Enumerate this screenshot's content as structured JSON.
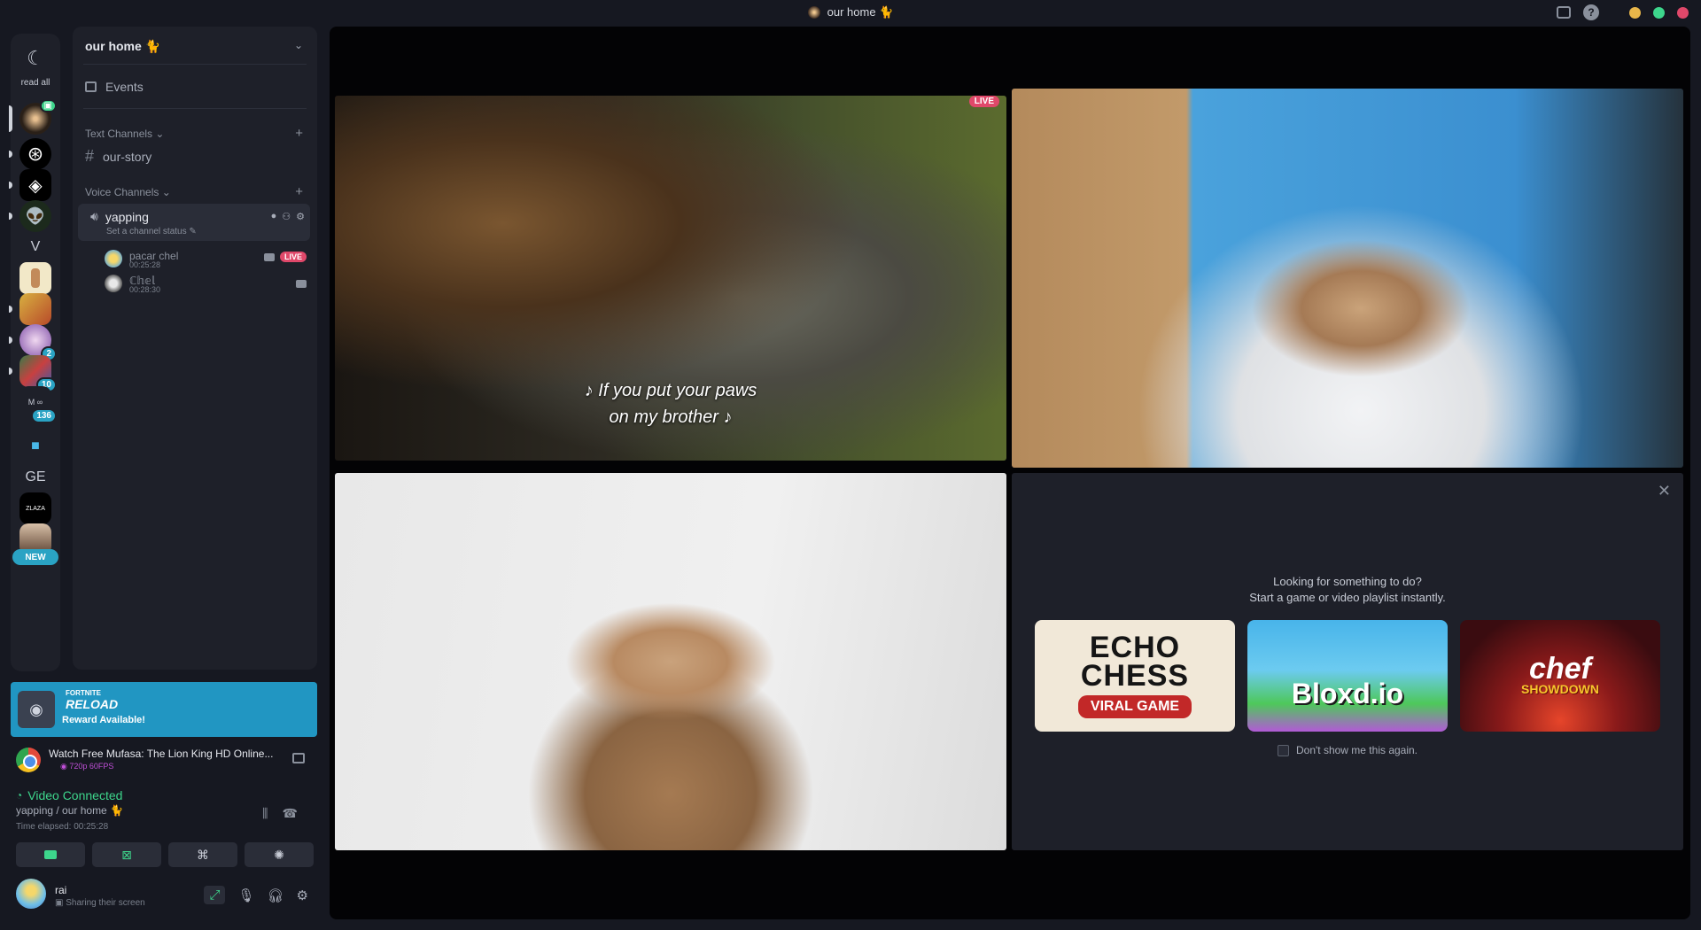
{
  "window": {
    "title": "our home 🐈",
    "controls": {
      "inbox_icon": "inbox-icon",
      "help_icon": "help-icon"
    },
    "traffic_colors": [
      "#e8b64a",
      "#3dd68c",
      "#e0486a"
    ]
  },
  "rail": {
    "read_all": "read all",
    "servers": [
      {
        "name": "our-home",
        "unread": true
      },
      {
        "name": "openai"
      },
      {
        "name": "diamond"
      },
      {
        "name": "alien"
      },
      {
        "name": "v",
        "text": "V"
      },
      {
        "name": "character"
      },
      {
        "name": "fortnite"
      },
      {
        "name": "server-2",
        "badge": "2"
      },
      {
        "name": "server-10",
        "badge": "10"
      },
      {
        "name": "server-136",
        "badge": "136"
      },
      {
        "name": "folder"
      },
      {
        "name": "ge",
        "text": "GE"
      },
      {
        "name": "zlaza"
      },
      {
        "name": "new-server",
        "badge": "NEW"
      }
    ]
  },
  "sidebar": {
    "server_name": "our home 🐈",
    "events_label": "Events",
    "text_category": "Text Channels",
    "text_channels": [
      {
        "label": "our-story"
      }
    ],
    "voice_category": "Voice Channels",
    "voice_channel": {
      "label": "yapping",
      "status_prompt": "Set a channel status"
    },
    "voice_users": [
      {
        "name": "pacar chel",
        "time": "00:25:28",
        "live": "LIVE"
      },
      {
        "name": "ℂ𝕙𝕖𝕝",
        "time": "00:28:30"
      }
    ]
  },
  "promo": {
    "brand": "FORTNITE",
    "title": "RELOAD",
    "subtitle": "Reward Available!"
  },
  "activity": {
    "title": "Watch Free Mufasa: The Lion King HD Online...",
    "quality": "720p 60FPS"
  },
  "voice": {
    "status": "Video Connected",
    "location": "yapping / our home 🐈",
    "elapsed": "Time elapsed: 00:25:28"
  },
  "user": {
    "name": "rai",
    "status": "Sharing their screen"
  },
  "stage": {
    "subtitle_line1": "♪ If you put your paws",
    "subtitle_line2": "on my brother ♪",
    "live_tag": "LIVE",
    "activity_heading_1": "Looking for something to do?",
    "activity_heading_2": "Start a game or video playlist instantly.",
    "games": [
      {
        "title_1": "ECHO",
        "title_2": "CHESS",
        "tag": "VIRAL GAME"
      },
      {
        "title": "Bloxd.io"
      },
      {
        "title": "chef",
        "subtitle": "SHOWDOWN"
      }
    ],
    "dont_show": "Don't show me this again."
  }
}
